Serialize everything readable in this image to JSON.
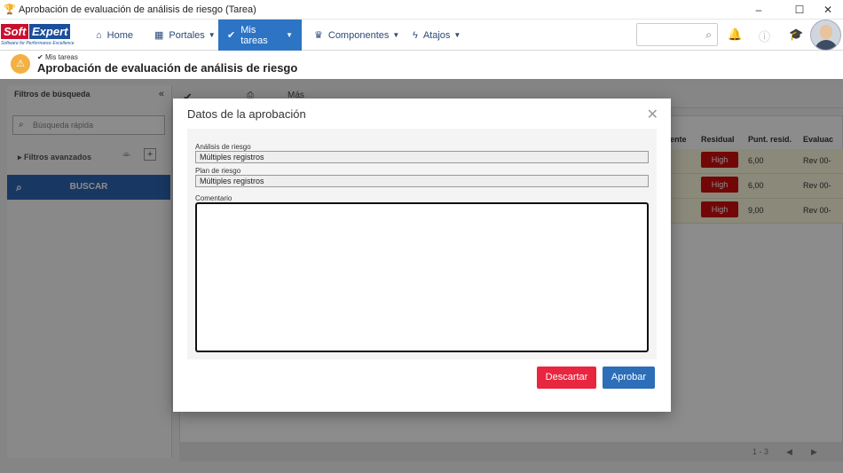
{
  "window": {
    "title": "Aprobación de evaluación de análisis de riesgo (Tarea)",
    "minimize": "–",
    "maximize": "☐",
    "close": "✕"
  },
  "logo": {
    "soft": "Soft",
    "expert": "Expert",
    "tagline": "Software for Performance Excellence"
  },
  "nav": {
    "items": [
      {
        "label": "Home",
        "icon": "home-icon"
      },
      {
        "label": "Portales",
        "icon": "grid-icon"
      },
      {
        "label": "Mis tareas",
        "icon": "check-icon"
      },
      {
        "label": "Componentes",
        "icon": "trophy-icon"
      },
      {
        "label": "Atajos",
        "icon": "bolt-icon"
      }
    ],
    "active_index": 2,
    "search_placeholder": ""
  },
  "page": {
    "breadcrumb": "Mis tareas",
    "title": "Aprobación de evaluación de análisis de riesgo"
  },
  "left_panel": {
    "title": "Filtros de búsqueda",
    "quick_search_placeholder": "Búsqueda rápida",
    "advanced_filters": "Filtros avanzados",
    "search_button": "BUSCAR"
  },
  "toolbar": {
    "more": "Más"
  },
  "grid": {
    "columns": [
      "ente",
      "Residual",
      "Punt. resid.",
      "Evaluac"
    ],
    "rows": [
      {
        "residual": "High",
        "score": "6,00",
        "eval": "Rev 00-"
      },
      {
        "residual": "High",
        "score": "6,00",
        "eval": "Rev 00-"
      },
      {
        "residual": "High",
        "score": "9,00",
        "eval": "Rev 00-"
      }
    ],
    "pager": "1 - 3"
  },
  "modal": {
    "title": "Datos de la aprobación",
    "close": "✕",
    "fields": {
      "risk_analysis_label": "Análisis de riesgo",
      "risk_analysis_value": "Múltiples registros",
      "risk_plan_label": "Plan de riesgo",
      "risk_plan_value": "Múltiples registros",
      "comment_label": "Comentario",
      "comment_value": ""
    },
    "discard": "Descartar",
    "approve": "Aprobar"
  },
  "colors": {
    "nav_active": "#2d74c4",
    "discard": "#e8263f",
    "approve": "#2d6eb8",
    "high_badge": "#d00e0e",
    "warning": "#f3b043"
  }
}
